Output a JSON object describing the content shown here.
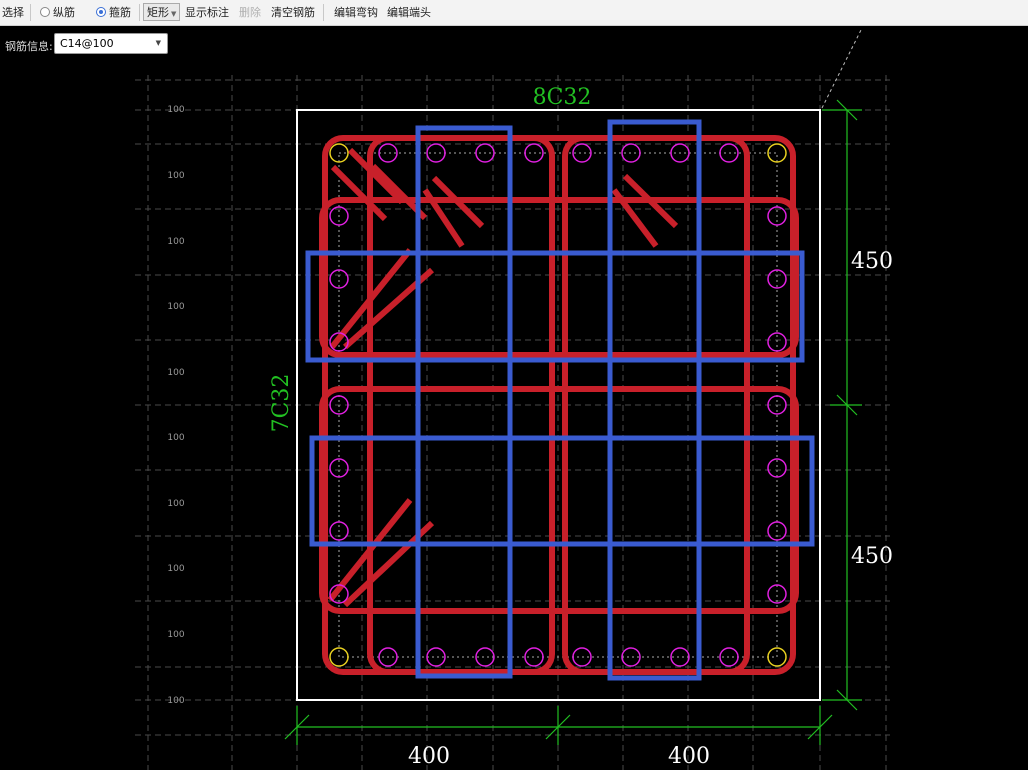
{
  "toolbar": {
    "select_label": "选择",
    "longitudinal_label": "纵筋",
    "stirrup_label": "箍筋",
    "shape_value": "矩形",
    "show_annotation_label": "显示标注",
    "delete_label": "删除",
    "clear_rebar_label": "清空钢筋",
    "edit_hook_label": "编辑弯钩",
    "edit_end_label": "编辑端头"
  },
  "rebar_info": {
    "label": "钢筋信息:",
    "value": "C14@100"
  },
  "drawing": {
    "top_rebar_label": "8C32",
    "side_rebar_label": "7C32",
    "dim_right_top": "450",
    "dim_right_bottom": "450",
    "dim_bottom_left": "400",
    "dim_bottom_right": "400",
    "spacing_labels": [
      "100",
      "100",
      "100",
      "100",
      "100",
      "100",
      "100",
      "100",
      "100",
      "100"
    ]
  },
  "colors": {
    "stirrup_red": "#c8202a",
    "stirrup_blue": "#3a5bd0",
    "dimension_green": "#22c022",
    "rebar_magenta": "#e020e0",
    "corner_yellow": "#e8d020"
  }
}
